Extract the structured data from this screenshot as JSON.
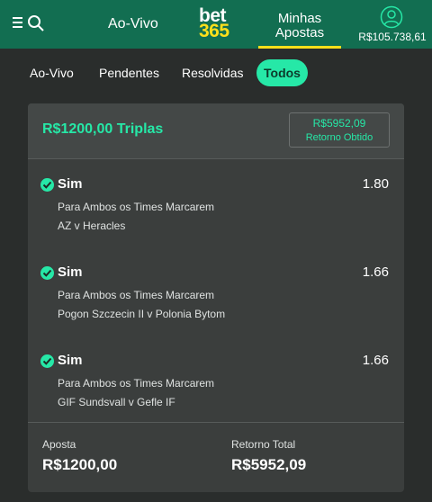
{
  "header": {
    "live_label": "Ao-Vivo",
    "logo_top": "bet",
    "logo_bottom": "365",
    "mybets_line1": "Minhas",
    "mybets_line2": "Apostas",
    "balance": "R$105.738,61"
  },
  "tabs": [
    {
      "label": "Ao-Vivo",
      "active": false
    },
    {
      "label": "Pendentes",
      "active": false
    },
    {
      "label": "Resolvidas",
      "active": false
    },
    {
      "label": "Todos",
      "active": true
    }
  ],
  "bet": {
    "title": "R$1200,00 Triplas",
    "cashout_amount": "R$5952,09",
    "cashout_label": "Retorno Obtido",
    "selections": [
      {
        "name": "Sim",
        "odds": "1.80",
        "market": "Para Ambos os Times Marcarem",
        "event": "AZ v Heracles"
      },
      {
        "name": "Sim",
        "odds": "1.66",
        "market": "Para Ambos os Times Marcarem",
        "event": "Pogon Szczecin II v Polonia Bytom"
      },
      {
        "name": "Sim",
        "odds": "1.66",
        "market": "Para Ambos os Times Marcarem",
        "event": "GIF Sundsvall v Gefle IF"
      }
    ],
    "stake_label": "Aposta",
    "stake_value": "R$1200,00",
    "return_label": "Retorno Total",
    "return_value": "R$5952,09"
  },
  "colors": {
    "header_bg": "#126e51",
    "accent_green": "#26e8a7",
    "brand_yellow": "#ffdf1b",
    "page_bg": "#2a2d2c"
  },
  "icons": [
    "menu-icon",
    "search-icon",
    "account-icon",
    "check-icon"
  ]
}
